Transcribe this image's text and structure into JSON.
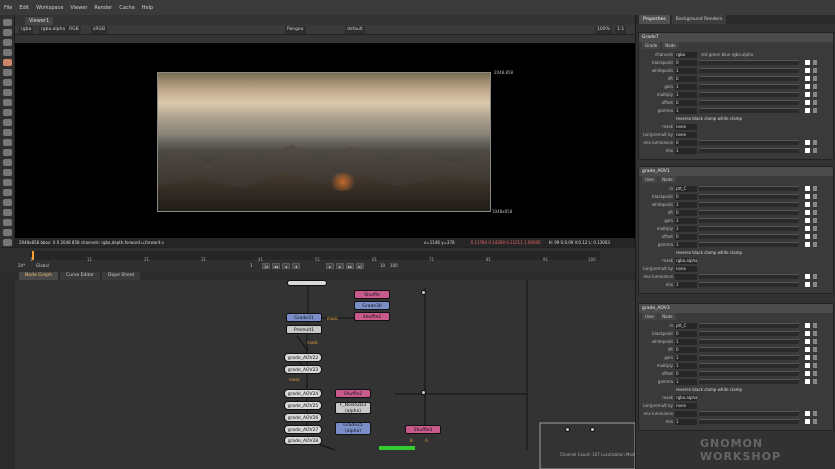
{
  "menubar": {
    "items": [
      "File",
      "Edit",
      "Workspace",
      "Viewer",
      "Render",
      "Cache",
      "Help"
    ]
  },
  "viewer": {
    "tab": "Viewer1",
    "channels": "rgba",
    "layer": "rgba.alpha",
    "rgb": "RGB",
    "colorspace": "sRGB",
    "zoom": "100%",
    "frame": "Pangea",
    "proxy": "1:1",
    "mode": "default",
    "label_top_right": "2048,858",
    "label_bottom_right": "1048x858",
    "status_left": "2048x858  bbox: 0 0 2048 858 channels: rgba,depth,forward.u,forward.v",
    "status_coords": "x=1146 y=378",
    "status_rgba": "0.11784 0.14309 0.11211 1.00000",
    "status_hsv": "H: 99 S:0.09 V:0.12 L: 0.13003"
  },
  "timeline": {
    "ticks": [
      "1",
      "11",
      "21",
      "31",
      "41",
      "51",
      "61",
      "71",
      "81",
      "91",
      "100"
    ],
    "fps": "24*",
    "mode": "Global",
    "frame": "1",
    "inc": "10",
    "end": "100"
  },
  "dag": {
    "tabs": [
      "Node Graph",
      "Curve Editor",
      "Dope Sheet"
    ],
    "status": "Channel Count: 167 Localization Mode: On Memory: 4.9 GB (7.4%) Disk: 35.1 GB (36.1%) Network: 8.1 GB",
    "nodes": {
      "n1": "Shuffle",
      "n2": "Grade30",
      "n3": "Shuffle1",
      "n4": "Grade31",
      "n5": "Premult1",
      "n6": "grade_AOV22",
      "n7": "grade_AOV23",
      "n8": "grade_AOV24",
      "n9": "grade_AOV25",
      "n10": "grade_AOV26",
      "n11": "grade_AOV27",
      "n12": "grade_AOV28",
      "n13": "Shuffle2",
      "n14": "F_Noise2D3\n(alpha)",
      "n15": "Grade25\n(alpha)",
      "n16": "Shuffle3",
      "n17": "ChannelMerge1"
    },
    "edge_labels": [
      "mask",
      "mask",
      "mask",
      "mask",
      "mask",
      "B",
      "A",
      "mask"
    ]
  },
  "panel": {
    "tabs": [
      "Properties",
      "Background Renders"
    ],
    "sections": [
      {
        "name": "Grade7",
        "tabs": [
          "Grade",
          "Node"
        ],
        "rows": [
          {
            "label": "channels",
            "value": "rgba",
            "extra": "red  green  blue  rgba.alpha"
          },
          {
            "label": "blackpoint",
            "value": "0"
          },
          {
            "label": "whitepoint",
            "value": "1"
          },
          {
            "label": "lift",
            "value": "0"
          },
          {
            "label": "gain",
            "value": "1"
          },
          {
            "label": "multiply",
            "value": "1"
          },
          {
            "label": "offset",
            "value": "0"
          },
          {
            "label": "gamma",
            "value": "1"
          },
          {
            "label": "",
            "value": "reverse  black clamp  white clamp"
          },
          {
            "label": "mask",
            "value": "none"
          },
          {
            "label": "(un)premult by",
            "value": "none"
          },
          {
            "label": "mix luminance",
            "value": "0"
          },
          {
            "label": "mix",
            "value": "1"
          }
        ]
      },
      {
        "name": "grade_AOV1",
        "tabs": [
          "User",
          "Node"
        ],
        "rows": [
          {
            "label": "in",
            "value": "ptt_C"
          },
          {
            "label": "blackpoint",
            "value": "0"
          },
          {
            "label": "whitepoint",
            "value": "1"
          },
          {
            "label": "lift",
            "value": "0"
          },
          {
            "label": "gain",
            "value": "1"
          },
          {
            "label": "multiply",
            "value": "1"
          },
          {
            "label": "offset",
            "value": "0"
          },
          {
            "label": "gamma",
            "value": "1"
          },
          {
            "label": "",
            "value": "reverse  black clamp  white clamp"
          },
          {
            "label": "mask",
            "value": "rgba.alpha"
          },
          {
            "label": "(un)premult by",
            "value": "none"
          },
          {
            "label": "mix luminance",
            "value": ""
          },
          {
            "label": "mix",
            "value": "1"
          }
        ]
      },
      {
        "name": "grade_AOV3",
        "tabs": [
          "User",
          "Node"
        ],
        "rows": [
          {
            "label": "in",
            "value": "ptt_C"
          },
          {
            "label": "blackpoint",
            "value": "0"
          },
          {
            "label": "whitepoint",
            "value": "1"
          },
          {
            "label": "lift",
            "value": "0"
          },
          {
            "label": "gain",
            "value": "1"
          },
          {
            "label": "multiply",
            "value": "1"
          },
          {
            "label": "offset",
            "value": "0"
          },
          {
            "label": "gamma",
            "value": "1"
          },
          {
            "label": "",
            "value": "reverse  black clamp  white clamp"
          },
          {
            "label": "mask",
            "value": "rgba.alpha"
          },
          {
            "label": "(un)premult by",
            "value": "none"
          },
          {
            "label": "mix luminance",
            "value": ""
          },
          {
            "label": "mix",
            "value": "1"
          }
        ]
      }
    ]
  },
  "watermark": "GNOMON WORKSHOP"
}
